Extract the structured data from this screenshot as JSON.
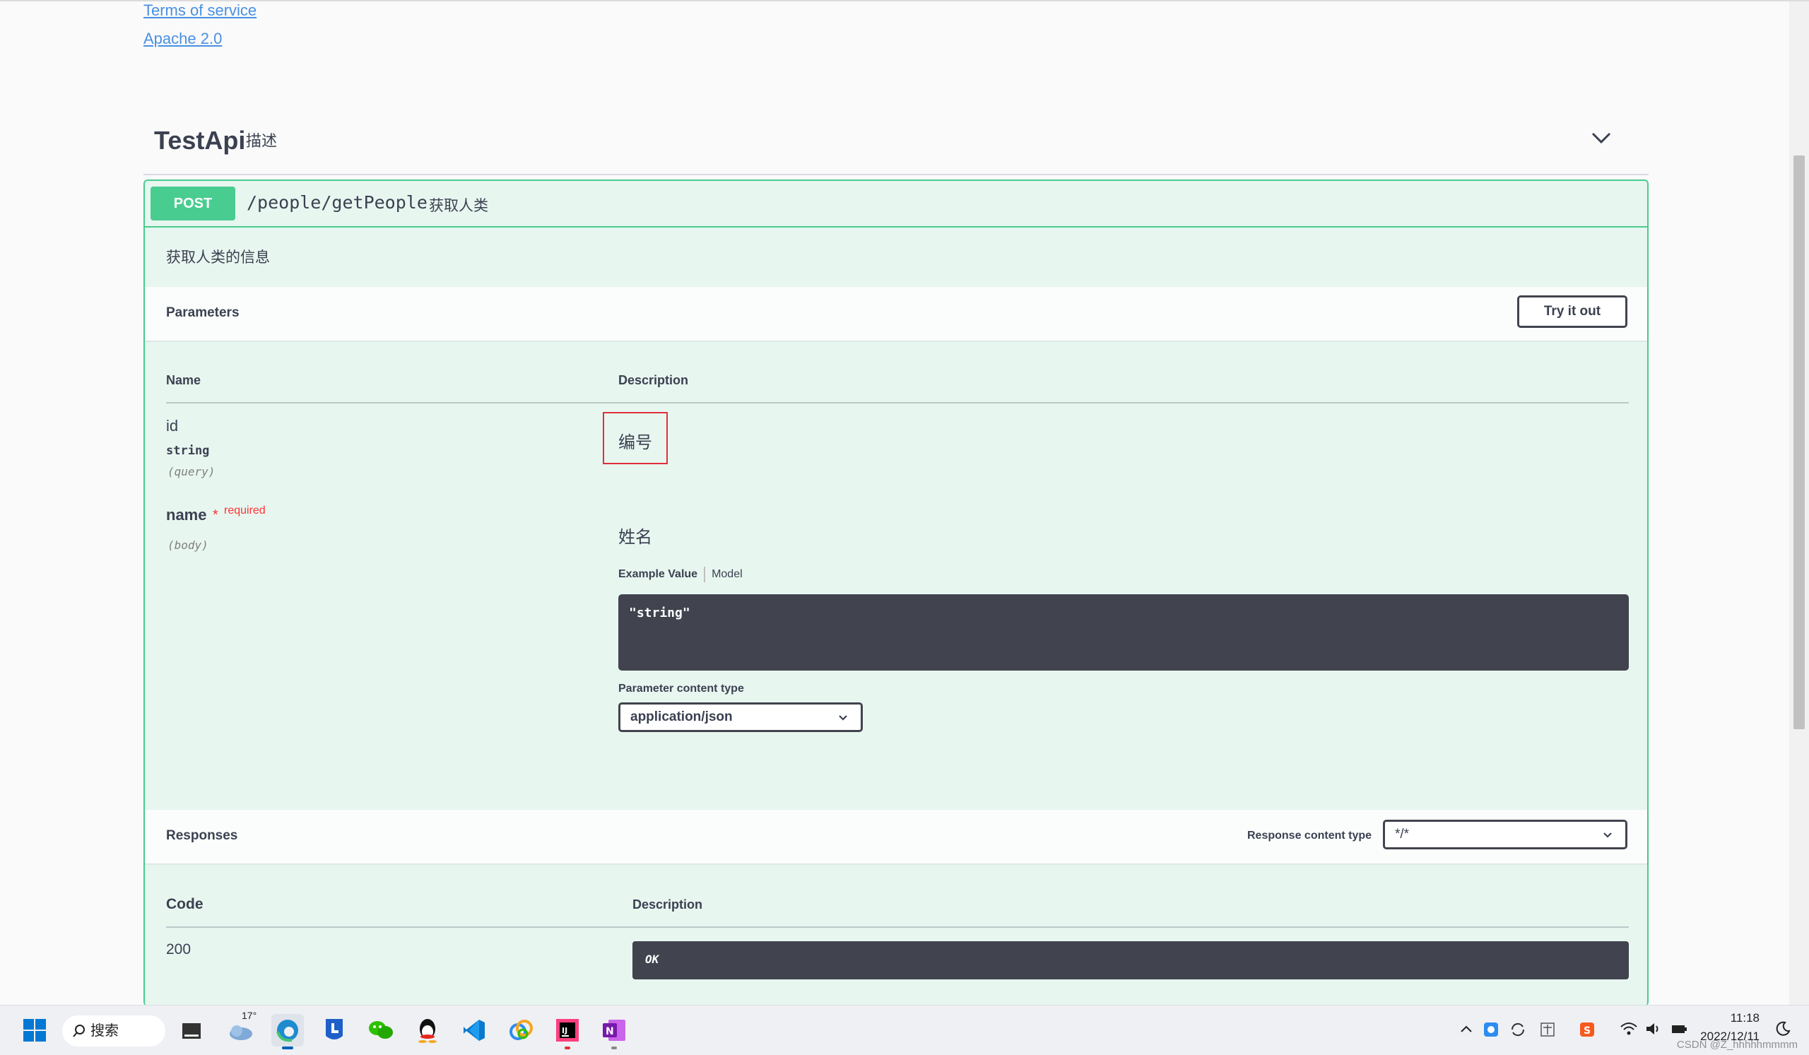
{
  "info": {
    "terms_link": "Terms of service",
    "license_link": "Apache 2.0"
  },
  "tag": {
    "name": "TestApi",
    "description": "描述"
  },
  "operation": {
    "method": "POST",
    "path": "/people/getPeople",
    "summary": "获取人类",
    "description": "获取人类的信息"
  },
  "parameters": {
    "title": "Parameters",
    "try_button": "Try it out",
    "col_name": "Name",
    "col_description": "Description",
    "items": [
      {
        "name": "id",
        "type": "string",
        "in": "(query)",
        "description": "编号"
      },
      {
        "name": "name",
        "required_marker": "*",
        "required_text": "required",
        "in": "(body)",
        "description": "姓名"
      }
    ],
    "example_tab": "Example Value",
    "model_tab": "Model",
    "example_value": "\"string\"",
    "content_type_label": "Parameter content type",
    "content_type_value": "application/json"
  },
  "responses": {
    "title": "Responses",
    "content_type_label": "Response content type",
    "content_type_value": "*/*",
    "col_code": "Code",
    "col_description": "Description",
    "items": [
      {
        "code": "200",
        "description": "OK"
      }
    ]
  },
  "taskbar": {
    "search_label": "搜索",
    "weather_temp": "17°",
    "time": "11:18",
    "date": "2022/12/11",
    "watermark": "CSDN @Z_hhhhhmmmm",
    "apps": [
      "start-icon",
      "search-icon",
      "file-explorer-icon",
      "weather-icon",
      "edge-icon",
      "lenovo-icon",
      "wechat-icon",
      "qq-icon",
      "vscode-icon",
      "app-icon",
      "intellij-icon",
      "onenote-icon"
    ]
  },
  "colors": {
    "post_green": "#49cc90",
    "op_bg": "#e8f6f0",
    "code_bg": "#41444e",
    "required_red": "#ff3333",
    "highlight_red": "#e0303a",
    "link_blue": "#4990e2"
  }
}
